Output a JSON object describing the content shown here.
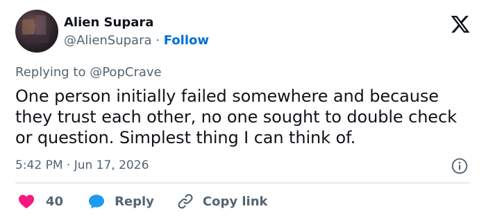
{
  "author": {
    "name": "Alien Supara",
    "handle": "@AlienSupara",
    "separator": "·",
    "follow_label": "Follow"
  },
  "replying": {
    "prefix": "Replying to",
    "mention": "@PopCrave"
  },
  "tweet": {
    "text": "One person initially failed somewhere and because they trust each other, no one sought to double check or question. Simplest thing I can think of."
  },
  "meta": {
    "timestamp": "5:42 PM · Jun 17, 2026"
  },
  "actions": {
    "like_count": "40",
    "reply_label": "Reply",
    "copy_label": "Copy link"
  },
  "colors": {
    "like": "#f91880",
    "reply": "#1d9bf0",
    "follow": "#006fd6",
    "muted": "#536471"
  },
  "icons": [
    "x-logo-icon",
    "info-icon",
    "heart-icon",
    "reply-bubble-icon",
    "link-icon"
  ]
}
